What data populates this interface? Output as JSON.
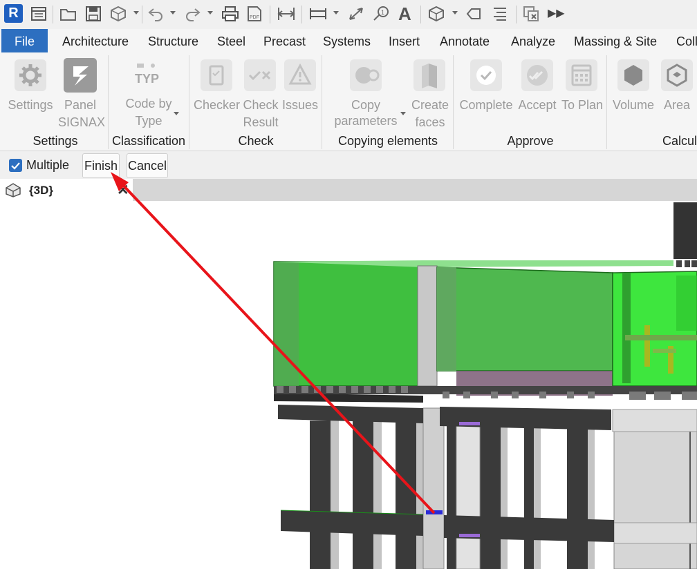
{
  "app": {
    "logo_letter": "R"
  },
  "tabs": [
    "File",
    "Architecture",
    "Structure",
    "Steel",
    "Precast",
    "Systems",
    "Insert",
    "Annotate",
    "Analyze",
    "Massing & Site",
    "Coll"
  ],
  "ribbon": {
    "settings": {
      "btn1_label": "Settings",
      "btn2_line1": "Panel",
      "btn2_line2": "SIGNAX",
      "group": "Settings"
    },
    "classification": {
      "icon_text": "TYP",
      "line1": "Code by",
      "line2": "Type",
      "group": "Classification"
    },
    "check": {
      "checker": "Checker",
      "check_line1": "Check",
      "check_line2": "Result",
      "issues": "Issues",
      "group": "Check"
    },
    "copying": {
      "copy_line1": "Copy",
      "copy_line2": "parameters",
      "create_line1": "Create",
      "create_line2": "faces",
      "group": "Copying elements"
    },
    "approve": {
      "complete": "Complete",
      "accept": "Accept",
      "to_plan": "To Plan",
      "group": "Approve"
    },
    "calc": {
      "volume": "Volume",
      "area": "Area",
      "group": "Calcula"
    }
  },
  "options_bar": {
    "multiple_label": "Multiple",
    "multiple_checked": true,
    "finish": "Finish",
    "cancel": "Cancel"
  },
  "view": {
    "tab_label": "{3D}"
  },
  "colors": {
    "accent": "#2d6fc0",
    "annotation_arrow": "#e8141a",
    "selection_green": "#3fbf3f"
  }
}
